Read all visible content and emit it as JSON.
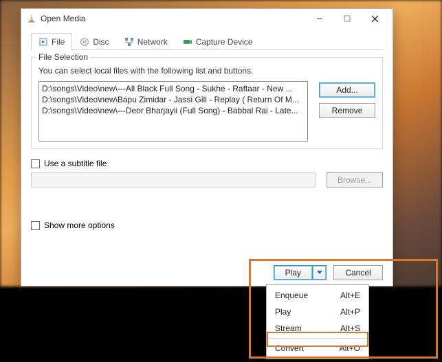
{
  "window": {
    "title": "Open Media"
  },
  "tabs": {
    "file": "File",
    "disc": "Disc",
    "network": "Network",
    "capture": "Capture Device"
  },
  "fileselection": {
    "legend": "File Selection",
    "hint": "You can select local files with the following list and buttons.",
    "items": [
      "D:\\songs\\Video\\new\\---All Black Full Song - Sukhe - Raftaar -  New ...",
      "D:\\songs\\Video\\new\\Bapu Zimidar - Jassi Gill - Replay ( Return Of M...",
      "D:\\songs\\Video\\new\\---Deor Bharjayii (Full Song) - Babbal Rai - Late..."
    ],
    "add": "Add...",
    "remove": "Remove"
  },
  "subtitle": {
    "label": "Use a subtitle file",
    "browse": "Browse..."
  },
  "options": {
    "showmore": "Show more options"
  },
  "buttons": {
    "play": "Play",
    "cancel": "Cancel"
  },
  "dropdown": {
    "items": [
      {
        "label": "Enqueue",
        "shortcut": "Alt+E"
      },
      {
        "label": "Play",
        "shortcut": "Alt+P"
      },
      {
        "label": "Stream",
        "shortcut": "Alt+S"
      },
      {
        "label": "Convert",
        "shortcut": "Alt+O"
      }
    ]
  }
}
